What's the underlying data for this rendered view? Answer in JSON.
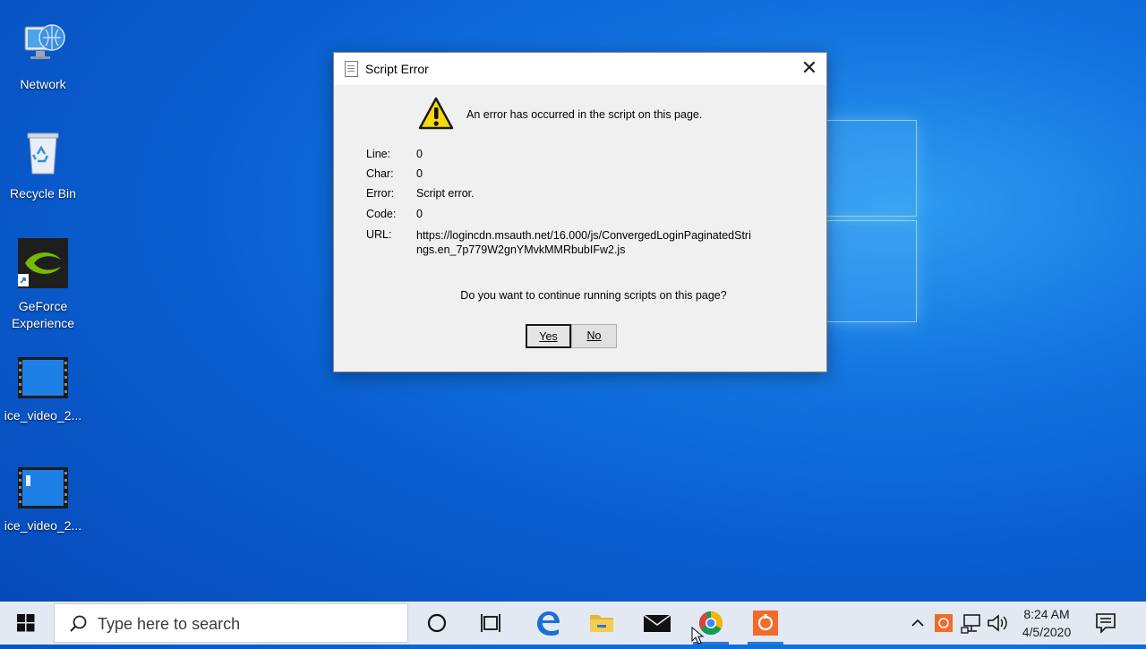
{
  "desktop": {
    "icons": [
      {
        "label": "Network",
        "icon": "network-icon"
      },
      {
        "label": "Recycle Bin",
        "icon": "recycle-bin-icon"
      },
      {
        "label": "GeForce Experience",
        "icon": "geforce-icon"
      },
      {
        "label": "ice_video_2...",
        "icon": "video-file-icon"
      },
      {
        "label": "ice_video_2...",
        "icon": "video-file-icon"
      }
    ]
  },
  "dialog": {
    "title": "Script Error",
    "close_symbol": "✕",
    "message": "An error has occurred in the script on this page.",
    "fields": [
      {
        "label": "Line:",
        "value": "0"
      },
      {
        "label": "Char:",
        "value": "0"
      },
      {
        "label": "Error:",
        "value": "Script error."
      },
      {
        "label": "Code:",
        "value": "0"
      },
      {
        "label": "URL:",
        "value": "https://logincdn.msauth.net/16.000/js/ConvergedLoginPaginatedStrings.en_7p779W2gnYMvkMMRbubIFw2.js"
      }
    ],
    "question": "Do you want to continue running scripts on this page?",
    "yes_label": "Yes",
    "no_label": "No"
  },
  "taskbar": {
    "search_placeholder": "Type here to search",
    "pinned": [
      "cortana-icon",
      "task-view-icon",
      "edge-icon",
      "file-explorer-icon",
      "mail-icon",
      "chrome-icon",
      "app-icon"
    ],
    "clock_time": "8:24 AM",
    "clock_date": "4/5/2020"
  },
  "colors": {
    "desktop_bg": "#0a5fd0",
    "taskbar_bg": "#e3e9f2",
    "active_indicator": "#2a78d4"
  }
}
